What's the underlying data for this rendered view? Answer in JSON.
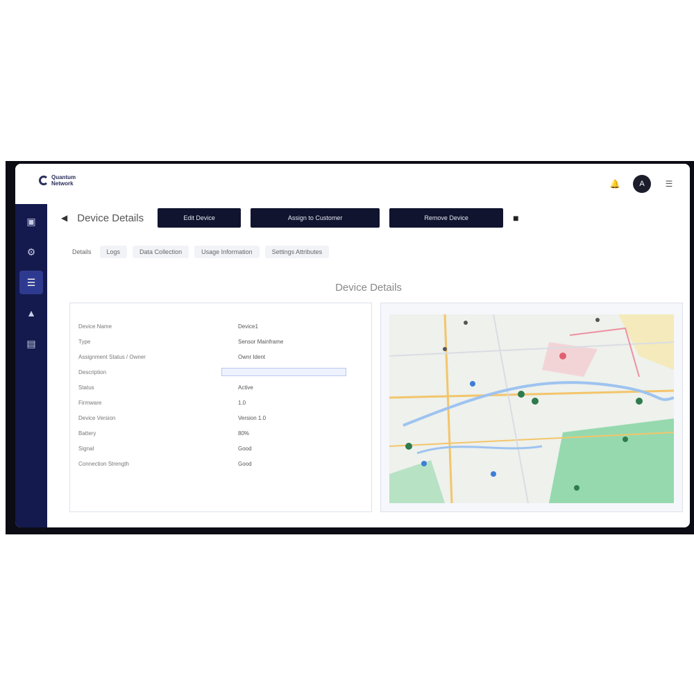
{
  "app": {
    "logo_text_line1": "Quantum",
    "logo_text_line2": "Network",
    "avatar_initial": "A"
  },
  "header": {
    "title": "Device Details",
    "buttons": [
      "Edit Device",
      "Assign to Customer",
      "Remove Device"
    ]
  },
  "tabs": [
    "Details",
    "Logs",
    "Data Collection",
    "Usage Information",
    "Settings Attributes"
  ],
  "section_title": "Device Details",
  "details": [
    {
      "key": "Device Name",
      "value": "Device1"
    },
    {
      "key": "Type",
      "value": "Sensor Mainframe"
    },
    {
      "key": "Assignment Status / Owner",
      "value": "Ownr Ident"
    },
    {
      "key": "Description",
      "value": ""
    },
    {
      "key": "Status",
      "value": "Active"
    },
    {
      "key": "Firmware",
      "value": "1.0"
    },
    {
      "key": "Device Version",
      "value": "Version 1.0"
    },
    {
      "key": "Battery",
      "value": "80%"
    },
    {
      "key": "Signal",
      "value": "Good"
    },
    {
      "key": "Connection Strength",
      "value": "Good"
    }
  ],
  "icons": {
    "back": "arrow-left-icon",
    "more": "more-icon",
    "bell": "bell-icon",
    "menu": "menu-icon"
  },
  "colors": {
    "sidebar": "#141a4d",
    "button": "#10142e",
    "map_green": "#7fd3a0",
    "map_road": "#f3c56b"
  }
}
